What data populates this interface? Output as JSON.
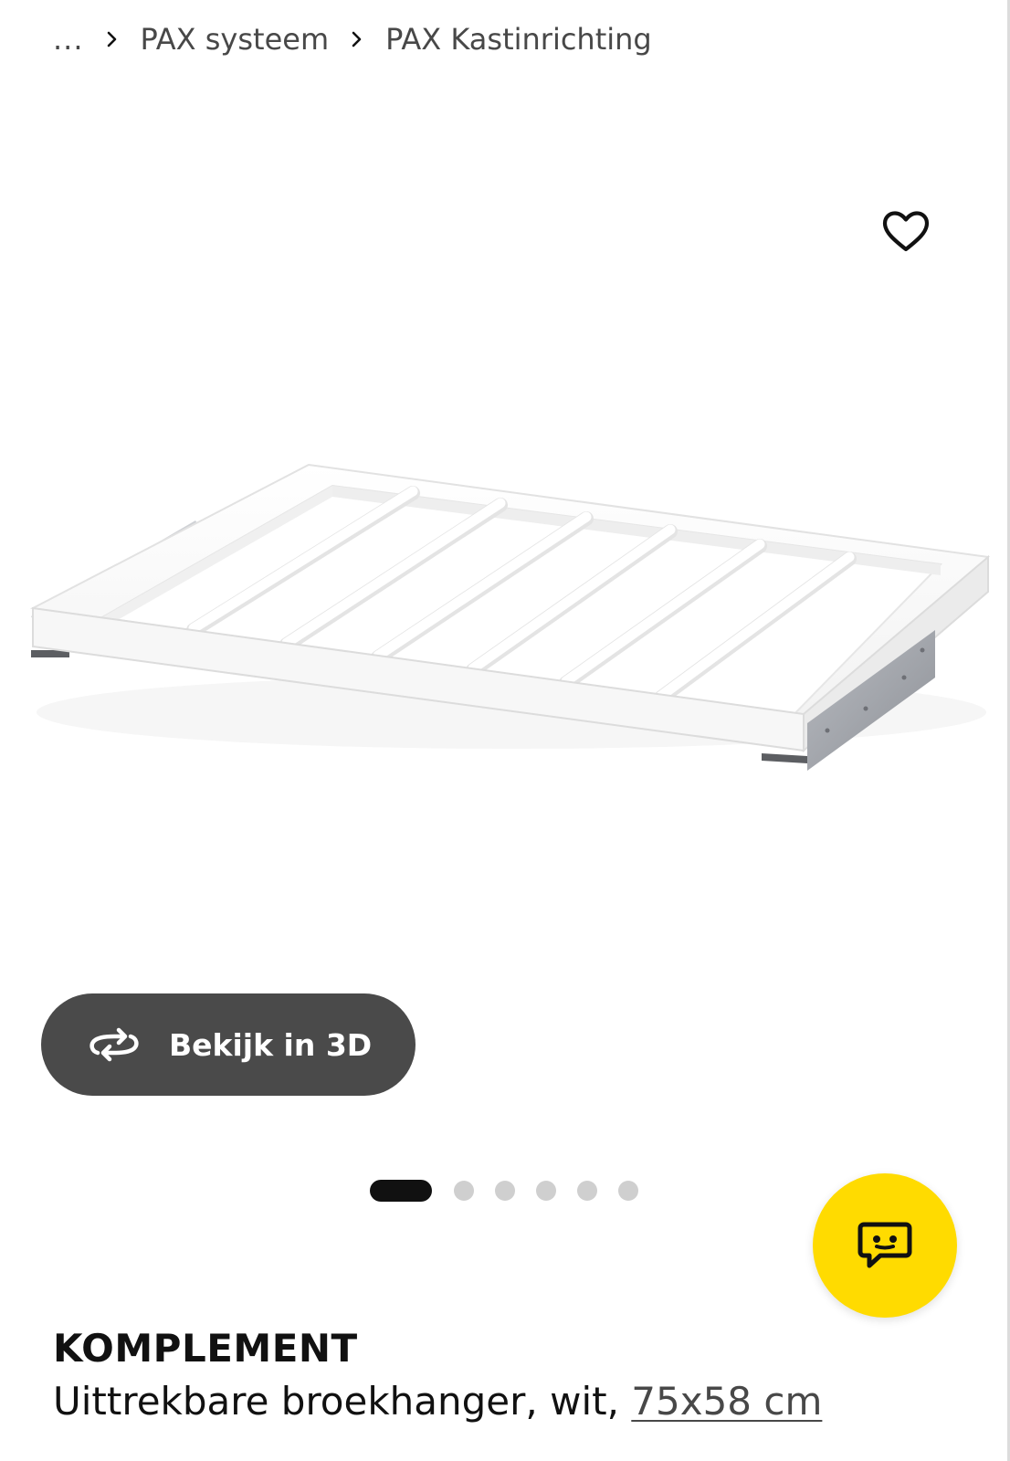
{
  "breadcrumb": {
    "ellipsis": "...",
    "items": [
      "PAX systeem",
      "PAX Kastinrichting"
    ]
  },
  "favorite": {
    "icon": "heart-outline-icon"
  },
  "product_image": {
    "alt": "KOMPLEMENT Uittrekbare broekhanger, wit"
  },
  "view3d": {
    "label": "Bekijk in 3D",
    "icon": "rotate-3d-icon"
  },
  "carousel": {
    "total": 6,
    "active_index": 0
  },
  "chat": {
    "icon": "chat-bubble-icon",
    "color": "#ffdb00"
  },
  "product": {
    "name": "KOMPLEMENT",
    "description": "Uittrekbare broekhanger, wit, ",
    "size": "75x58 cm"
  },
  "colors": {
    "accent_yellow": "#ffdb00",
    "button_dark": "#4a4a4a",
    "text": "#111111",
    "muted_text": "#484848"
  }
}
